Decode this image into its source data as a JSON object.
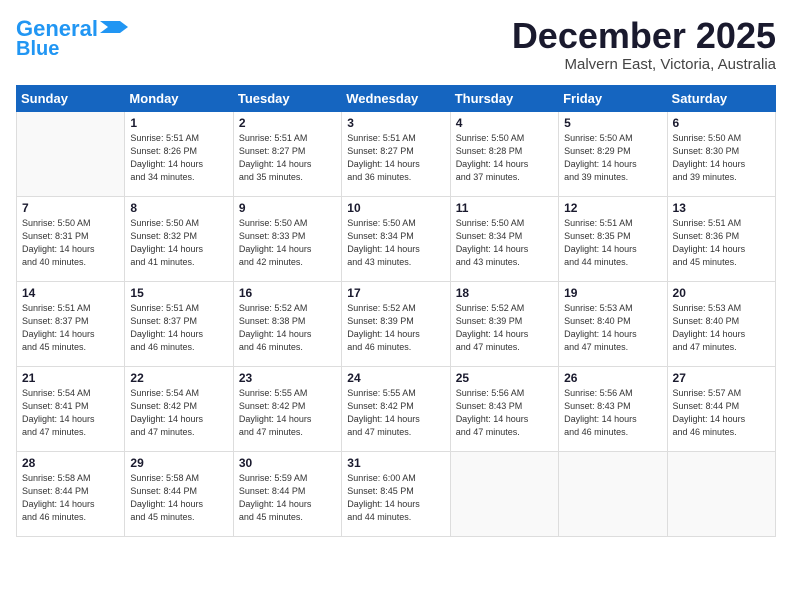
{
  "logo": {
    "text1": "General",
    "text2": "Blue"
  },
  "header": {
    "month": "December 2025",
    "location": "Malvern East, Victoria, Australia"
  },
  "weekdays": [
    "Sunday",
    "Monday",
    "Tuesday",
    "Wednesday",
    "Thursday",
    "Friday",
    "Saturday"
  ],
  "weeks": [
    [
      {
        "day": "",
        "info": ""
      },
      {
        "day": "1",
        "info": "Sunrise: 5:51 AM\nSunset: 8:26 PM\nDaylight: 14 hours\nand 34 minutes."
      },
      {
        "day": "2",
        "info": "Sunrise: 5:51 AM\nSunset: 8:27 PM\nDaylight: 14 hours\nand 35 minutes."
      },
      {
        "day": "3",
        "info": "Sunrise: 5:51 AM\nSunset: 8:27 PM\nDaylight: 14 hours\nand 36 minutes."
      },
      {
        "day": "4",
        "info": "Sunrise: 5:50 AM\nSunset: 8:28 PM\nDaylight: 14 hours\nand 37 minutes."
      },
      {
        "day": "5",
        "info": "Sunrise: 5:50 AM\nSunset: 8:29 PM\nDaylight: 14 hours\nand 39 minutes."
      },
      {
        "day": "6",
        "info": "Sunrise: 5:50 AM\nSunset: 8:30 PM\nDaylight: 14 hours\nand 39 minutes."
      }
    ],
    [
      {
        "day": "7",
        "info": "Sunrise: 5:50 AM\nSunset: 8:31 PM\nDaylight: 14 hours\nand 40 minutes."
      },
      {
        "day": "8",
        "info": "Sunrise: 5:50 AM\nSunset: 8:32 PM\nDaylight: 14 hours\nand 41 minutes."
      },
      {
        "day": "9",
        "info": "Sunrise: 5:50 AM\nSunset: 8:33 PM\nDaylight: 14 hours\nand 42 minutes."
      },
      {
        "day": "10",
        "info": "Sunrise: 5:50 AM\nSunset: 8:34 PM\nDaylight: 14 hours\nand 43 minutes."
      },
      {
        "day": "11",
        "info": "Sunrise: 5:50 AM\nSunset: 8:34 PM\nDaylight: 14 hours\nand 43 minutes."
      },
      {
        "day": "12",
        "info": "Sunrise: 5:51 AM\nSunset: 8:35 PM\nDaylight: 14 hours\nand 44 minutes."
      },
      {
        "day": "13",
        "info": "Sunrise: 5:51 AM\nSunset: 8:36 PM\nDaylight: 14 hours\nand 45 minutes."
      }
    ],
    [
      {
        "day": "14",
        "info": "Sunrise: 5:51 AM\nSunset: 8:37 PM\nDaylight: 14 hours\nand 45 minutes."
      },
      {
        "day": "15",
        "info": "Sunrise: 5:51 AM\nSunset: 8:37 PM\nDaylight: 14 hours\nand 46 minutes."
      },
      {
        "day": "16",
        "info": "Sunrise: 5:52 AM\nSunset: 8:38 PM\nDaylight: 14 hours\nand 46 minutes."
      },
      {
        "day": "17",
        "info": "Sunrise: 5:52 AM\nSunset: 8:39 PM\nDaylight: 14 hours\nand 46 minutes."
      },
      {
        "day": "18",
        "info": "Sunrise: 5:52 AM\nSunset: 8:39 PM\nDaylight: 14 hours\nand 47 minutes."
      },
      {
        "day": "19",
        "info": "Sunrise: 5:53 AM\nSunset: 8:40 PM\nDaylight: 14 hours\nand 47 minutes."
      },
      {
        "day": "20",
        "info": "Sunrise: 5:53 AM\nSunset: 8:40 PM\nDaylight: 14 hours\nand 47 minutes."
      }
    ],
    [
      {
        "day": "21",
        "info": "Sunrise: 5:54 AM\nSunset: 8:41 PM\nDaylight: 14 hours\nand 47 minutes."
      },
      {
        "day": "22",
        "info": "Sunrise: 5:54 AM\nSunset: 8:42 PM\nDaylight: 14 hours\nand 47 minutes."
      },
      {
        "day": "23",
        "info": "Sunrise: 5:55 AM\nSunset: 8:42 PM\nDaylight: 14 hours\nand 47 minutes."
      },
      {
        "day": "24",
        "info": "Sunrise: 5:55 AM\nSunset: 8:42 PM\nDaylight: 14 hours\nand 47 minutes."
      },
      {
        "day": "25",
        "info": "Sunrise: 5:56 AM\nSunset: 8:43 PM\nDaylight: 14 hours\nand 47 minutes."
      },
      {
        "day": "26",
        "info": "Sunrise: 5:56 AM\nSunset: 8:43 PM\nDaylight: 14 hours\nand 46 minutes."
      },
      {
        "day": "27",
        "info": "Sunrise: 5:57 AM\nSunset: 8:44 PM\nDaylight: 14 hours\nand 46 minutes."
      }
    ],
    [
      {
        "day": "28",
        "info": "Sunrise: 5:58 AM\nSunset: 8:44 PM\nDaylight: 14 hours\nand 46 minutes."
      },
      {
        "day": "29",
        "info": "Sunrise: 5:58 AM\nSunset: 8:44 PM\nDaylight: 14 hours\nand 45 minutes."
      },
      {
        "day": "30",
        "info": "Sunrise: 5:59 AM\nSunset: 8:44 PM\nDaylight: 14 hours\nand 45 minutes."
      },
      {
        "day": "31",
        "info": "Sunrise: 6:00 AM\nSunset: 8:45 PM\nDaylight: 14 hours\nand 44 minutes."
      },
      {
        "day": "",
        "info": ""
      },
      {
        "day": "",
        "info": ""
      },
      {
        "day": "",
        "info": ""
      }
    ]
  ]
}
